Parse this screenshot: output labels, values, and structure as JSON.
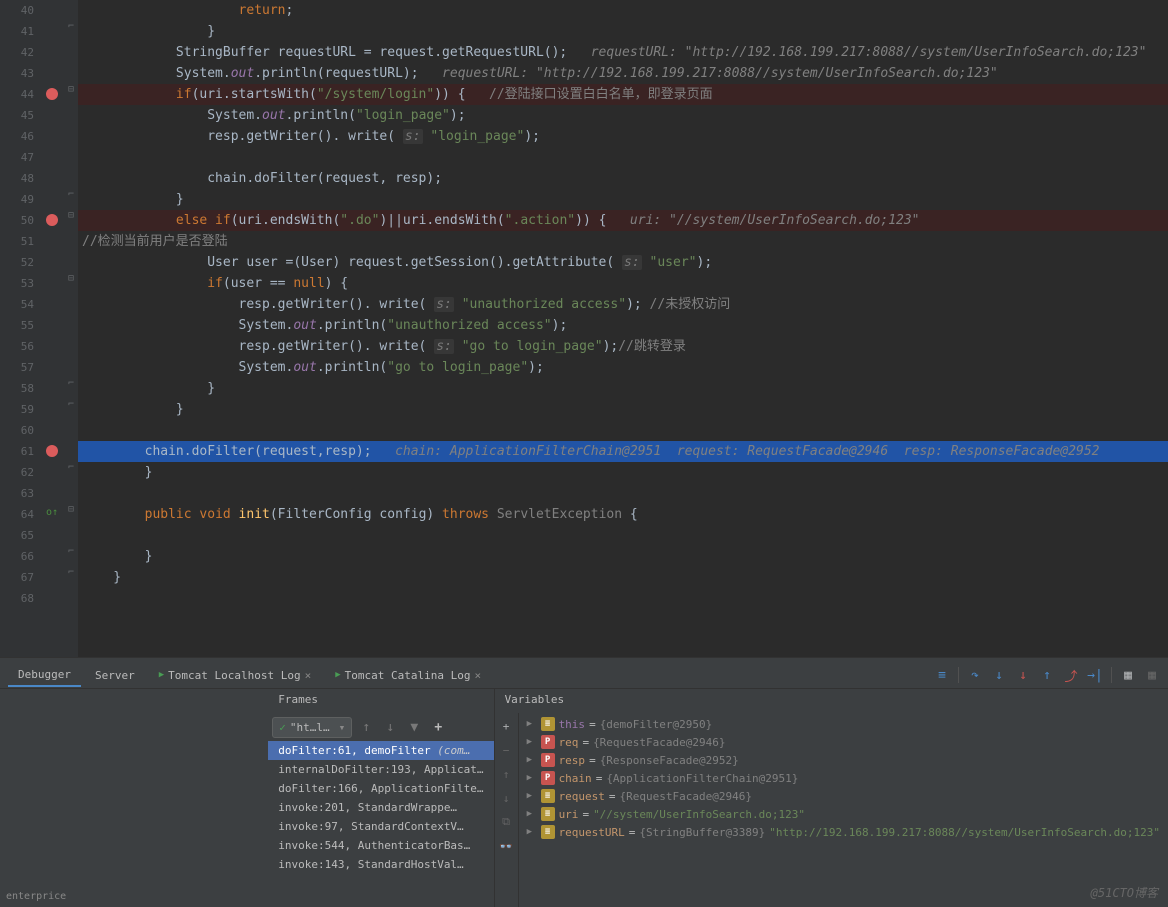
{
  "editor": {
    "lines": [
      {
        "n": 40,
        "tokens": [
          [
            "                    ",
            "text"
          ],
          [
            "return",
            "keyword"
          ],
          [
            ";",
            "text"
          ]
        ]
      },
      {
        "n": 41,
        "fold": "close",
        "tokens": [
          [
            "                }",
            "text"
          ]
        ]
      },
      {
        "n": 42,
        "tokens": [
          [
            "            StringBuffer requestURL = request.getRequestURL();   ",
            "text"
          ],
          [
            "requestURL: \"http://192.168.199.217:8088//system/UserInfoSearch.do;123\"",
            "comment-hint"
          ]
        ]
      },
      {
        "n": 43,
        "tokens": [
          [
            "            System.",
            "text"
          ],
          [
            "out",
            "field"
          ],
          [
            ".println(requestURL);   ",
            "text"
          ],
          [
            "requestURL: \"http://192.168.199.217:8088//system/UserInfoSearch.do;123\"",
            "comment-hint"
          ]
        ]
      },
      {
        "n": 44,
        "bp": true,
        "fold": "open",
        "tokens": [
          [
            "            ",
            "text"
          ],
          [
            "if",
            "keyword"
          ],
          [
            "(uri.startsWith(",
            "text"
          ],
          [
            "\"/system/login\"",
            "string"
          ],
          [
            ")) {   ",
            "text"
          ],
          [
            "//登陆接口设置白白名单，即登录页面",
            "comment"
          ]
        ]
      },
      {
        "n": 45,
        "tokens": [
          [
            "                System.",
            "text"
          ],
          [
            "out",
            "field"
          ],
          [
            ".println(",
            "text"
          ],
          [
            "\"login_page\"",
            "string"
          ],
          [
            ");",
            "text"
          ]
        ]
      },
      {
        "n": 46,
        "tokens": [
          [
            "                resp.getWriter(). write( ",
            "text"
          ],
          [
            "s:",
            "param-hint"
          ],
          [
            " ",
            "text"
          ],
          [
            "\"login_page\"",
            "string"
          ],
          [
            ");",
            "text"
          ]
        ]
      },
      {
        "n": 47,
        "tokens": [
          [
            "",
            "text"
          ]
        ]
      },
      {
        "n": 48,
        "tokens": [
          [
            "                chain.doFilter(request, resp);",
            "text"
          ]
        ]
      },
      {
        "n": 49,
        "fold": "close",
        "tokens": [
          [
            "            }",
            "text"
          ]
        ]
      },
      {
        "n": 50,
        "bp": true,
        "fold": "open",
        "tokens": [
          [
            "            ",
            "text"
          ],
          [
            "else if",
            "keyword"
          ],
          [
            "(uri.endsWith(",
            "text"
          ],
          [
            "\".do\"",
            "string"
          ],
          [
            ")||uri.endsWith(",
            "text"
          ],
          [
            "\".action\"",
            "string"
          ],
          [
            ")) {   ",
            "text"
          ],
          [
            "uri: \"//system/UserInfoSearch.do;123\"",
            "comment-hint"
          ]
        ]
      },
      {
        "n": 51,
        "tokens": [
          [
            "//检测当前用户是否登陆",
            "comment"
          ]
        ]
      },
      {
        "n": 52,
        "tokens": [
          [
            "                User user =(User) request.getSession().getAttribute( ",
            "text"
          ],
          [
            "s:",
            "param-hint"
          ],
          [
            " ",
            "text"
          ],
          [
            "\"user\"",
            "string"
          ],
          [
            ");",
            "text"
          ]
        ]
      },
      {
        "n": 53,
        "fold": "open",
        "tokens": [
          [
            "                ",
            "text"
          ],
          [
            "if",
            "keyword"
          ],
          [
            "(user == ",
            "text"
          ],
          [
            "null",
            "keyword"
          ],
          [
            ") {",
            "text"
          ]
        ]
      },
      {
        "n": 54,
        "tokens": [
          [
            "                    resp.getWriter(). write( ",
            "text"
          ],
          [
            "s:",
            "param-hint"
          ],
          [
            " ",
            "text"
          ],
          [
            "\"unauthorized access\"",
            "string"
          ],
          [
            "); ",
            "text"
          ],
          [
            "//未授权访问",
            "comment"
          ]
        ]
      },
      {
        "n": 55,
        "tokens": [
          [
            "                    System.",
            "text"
          ],
          [
            "out",
            "field"
          ],
          [
            ".println(",
            "text"
          ],
          [
            "\"unauthorized access\"",
            "string"
          ],
          [
            ");",
            "text"
          ]
        ]
      },
      {
        "n": 56,
        "tokens": [
          [
            "                    resp.getWriter(). write( ",
            "text"
          ],
          [
            "s:",
            "param-hint"
          ],
          [
            " ",
            "text"
          ],
          [
            "\"go to login_page\"",
            "string"
          ],
          [
            ");",
            "text"
          ],
          [
            "//跳转登录",
            "comment"
          ]
        ]
      },
      {
        "n": 57,
        "tokens": [
          [
            "                    System.",
            "text"
          ],
          [
            "out",
            "field"
          ],
          [
            ".println(",
            "text"
          ],
          [
            "\"go to login_page\"",
            "string"
          ],
          [
            ");",
            "text"
          ]
        ]
      },
      {
        "n": 58,
        "fold": "close",
        "tokens": [
          [
            "                }",
            "text"
          ]
        ]
      },
      {
        "n": 59,
        "fold": "close",
        "tokens": [
          [
            "            }",
            "text"
          ]
        ]
      },
      {
        "n": 60,
        "tokens": [
          [
            "",
            "text"
          ]
        ]
      },
      {
        "n": 61,
        "bp": true,
        "current": true,
        "tokens": [
          [
            "        chain.doFilter(request,resp);   ",
            "text"
          ],
          [
            "chain: ApplicationFilterChain@2951  request: RequestFacade@2946  resp: ResponseFacade@2952",
            "comment-hint"
          ]
        ]
      },
      {
        "n": 62,
        "fold": "close",
        "tokens": [
          [
            "        }",
            "text"
          ]
        ]
      },
      {
        "n": 63,
        "tokens": [
          [
            "",
            "text"
          ]
        ]
      },
      {
        "n": 64,
        "override": true,
        "fold": "open",
        "tokens": [
          [
            "        ",
            "text"
          ],
          [
            "public void ",
            "keyword"
          ],
          [
            "init",
            "method-name"
          ],
          [
            "(FilterConfig config) ",
            "text"
          ],
          [
            "throws ",
            "keyword"
          ],
          [
            "ServletException ",
            "comment"
          ],
          [
            "{",
            "text"
          ]
        ]
      },
      {
        "n": 65,
        "tokens": [
          [
            "",
            "text"
          ]
        ]
      },
      {
        "n": 66,
        "fold": "close",
        "tokens": [
          [
            "        }",
            "text"
          ]
        ]
      },
      {
        "n": 67,
        "fold": "close",
        "tokens": [
          [
            "    }",
            "text"
          ]
        ]
      },
      {
        "n": 68,
        "tokens": [
          [
            "",
            "text"
          ]
        ]
      }
    ]
  },
  "debugTabs": {
    "debugger": "Debugger",
    "server": "Server",
    "tomcatLocal": "Tomcat Localhost Log",
    "tomcatCatalina": "Tomcat Catalina Log"
  },
  "framesHeader": "Frames",
  "varsHeader": "Variables",
  "threadSelect": "\"ht…l…",
  "frames": [
    {
      "text": "doFilter:61, demoFilter ",
      "loc": "(com…",
      "selected": true
    },
    {
      "text": "internalDoFilter:193, Applicat…",
      "loc": ""
    },
    {
      "text": "doFilter:166, ApplicationFilte…",
      "loc": ""
    },
    {
      "text": "invoke:201, StandardWrappe…",
      "loc": ""
    },
    {
      "text": "invoke:97, StandardContextV…",
      "loc": ""
    },
    {
      "text": "invoke:544, AuthenticatorBas…",
      "loc": ""
    },
    {
      "text": "invoke:143, StandardHostVal…",
      "loc": ""
    }
  ],
  "variables": [
    {
      "icon": "f",
      "name": "this",
      "eq": " = ",
      "val": "{demoFilter@2950}",
      "nameClass": "purple"
    },
    {
      "icon": "p",
      "name": "req",
      "eq": " = ",
      "val": "{RequestFacade@2946}",
      "nameClass": "orange"
    },
    {
      "icon": "p",
      "name": "resp",
      "eq": " = ",
      "val": "{ResponseFacade@2952}",
      "nameClass": "orange"
    },
    {
      "icon": "p",
      "name": "chain",
      "eq": " = ",
      "val": "{ApplicationFilterChain@2951}",
      "nameClass": "orange"
    },
    {
      "icon": "f",
      "name": "request",
      "eq": " = ",
      "val": "{RequestFacade@2946}",
      "nameClass": "orange"
    },
    {
      "icon": "f",
      "name": "uri",
      "eq": " = ",
      "val": "",
      "str": "\"//system/UserInfoSearch.do;123\"",
      "nameClass": "orange"
    },
    {
      "icon": "f",
      "name": "requestURL",
      "eq": " = ",
      "val": "{StringBuffer@3389} ",
      "str": "\"http://192.168.199.217:8088//system/UserInfoSearch.do;123\"",
      "nameClass": "orange"
    }
  ],
  "watermark": "@51CTO博客",
  "statusbar": "enterprice"
}
